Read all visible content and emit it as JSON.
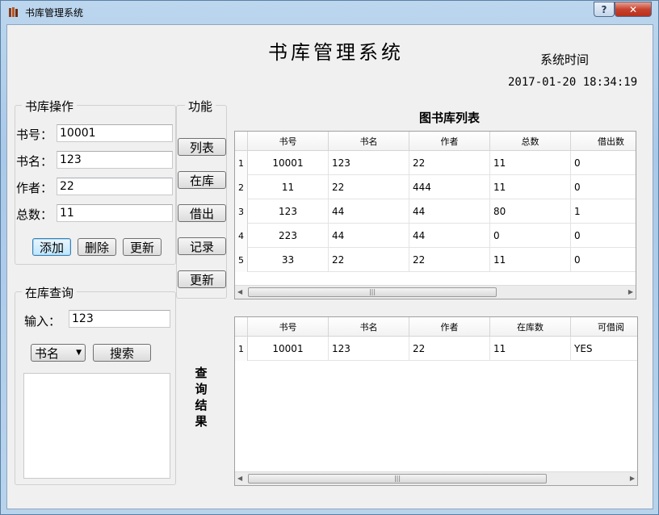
{
  "window": {
    "title": "书库管理系统",
    "help_glyph": "?",
    "close_glyph": "✕"
  },
  "header": {
    "title": "书库管理系统",
    "time_label": "系统时间",
    "time_value": "2017-01-20 18:34:19"
  },
  "operation": {
    "group_title": "书库操作",
    "fields": [
      {
        "label": "书号：",
        "value": "10001"
      },
      {
        "label": "书名：",
        "value": "123"
      },
      {
        "label": "作者：",
        "value": "22"
      },
      {
        "label": "总数：",
        "value": "11"
      }
    ],
    "buttons": {
      "add": "添加",
      "delete": "删除",
      "update": "更新"
    }
  },
  "functions": {
    "group_title": "功能",
    "buttons": {
      "list": "列表",
      "in_stock": "在库",
      "borrow": "借出",
      "record": "记录",
      "update": "更新"
    }
  },
  "query": {
    "group_title": "在库查询",
    "input_label": "输入：",
    "input_value": "123",
    "combo_value": "书名",
    "search_button": "搜索"
  },
  "book_list": {
    "title": "图书库列表",
    "columns": [
      "书号",
      "书名",
      "作者",
      "总数",
      "借出数"
    ],
    "rows": [
      {
        "num": "1",
        "cells": [
          "10001",
          "123",
          "22",
          "11",
          "0"
        ]
      },
      {
        "num": "2",
        "cells": [
          "11",
          "22",
          "444",
          "11",
          "0"
        ]
      },
      {
        "num": "3",
        "cells": [
          "123",
          "44",
          "44",
          "80",
          "1"
        ]
      },
      {
        "num": "4",
        "cells": [
          "223",
          "44",
          "44",
          "0",
          "0"
        ]
      },
      {
        "num": "5",
        "cells": [
          "33",
          "22",
          "22",
          "11",
          "0"
        ]
      }
    ]
  },
  "query_result": {
    "side_label": [
      "查",
      "询",
      "结",
      "果"
    ],
    "columns": [
      "书号",
      "书名",
      "作者",
      "在库数",
      "可借阅"
    ],
    "rows": [
      {
        "num": "1",
        "cells": [
          "10001",
          "123",
          "22",
          "11",
          "YES"
        ]
      }
    ]
  },
  "scroll_glyphs": {
    "left": "◀",
    "right": "▶",
    "grip": "|||"
  },
  "colors": {
    "close_button": "#c7432f",
    "titlebar": "#a9c9e8",
    "client_bg": "#f0f0f0"
  }
}
